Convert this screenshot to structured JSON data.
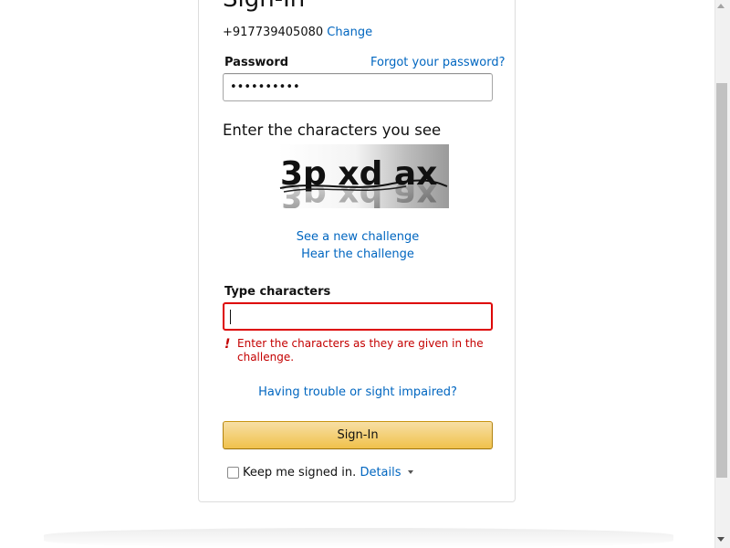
{
  "signin": {
    "title": "Sign-In",
    "phone": "+917739405080",
    "change_link": "Change",
    "password_label": "Password",
    "forgot_link": "Forgot your password?",
    "password_value": "••••••••••",
    "captcha_heading": "Enter the characters you see",
    "captcha_image_text": "3p xd ax",
    "new_challenge_link": "See a new challenge",
    "hear_challenge_link": "Hear the challenge",
    "type_characters_label": "Type characters",
    "type_characters_value": "",
    "error_icon": "!",
    "error_message": "Enter the characters as they are given in the challenge.",
    "trouble_link": "Having trouble or sight impaired?",
    "signin_button": "Sign-In",
    "keep_signed_in": "Keep me signed in.",
    "details_link": "Details"
  },
  "colors": {
    "link": "#0066c0",
    "error": "#c40000",
    "button_top": "#f7dfa5",
    "button_bottom": "#f0c14b"
  },
  "icons": {
    "error": "exclamation-icon",
    "details_caret": "caret-down-icon"
  }
}
